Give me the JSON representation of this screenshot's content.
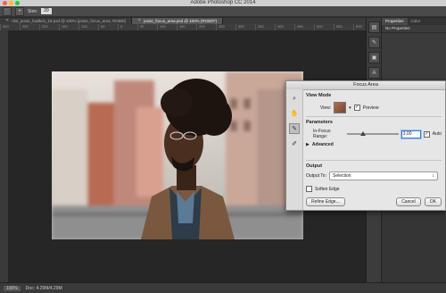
{
  "app": {
    "title": "Adobe Photoshop CC 2014",
    "traffic_light_colors": [
      "#ff5f57",
      "#febc2e",
      "#28c840"
    ]
  },
  "options_bar": {
    "tool_icon": "lasso-icon",
    "size_label": "Size:",
    "size_value": "20"
  },
  "tabs": [
    {
      "label": "rtist_jesse_fowlkes_18.psd @ 100% (jesse_focus_area, RGB/8)",
      "active": false
    },
    {
      "label": "jesse_focus_area.psd @ 100% (RGB/8*)",
      "active": true
    }
  ],
  "ruler": [
    "300",
    "250",
    "200",
    "150",
    "100",
    "50",
    "0",
    "50",
    "100",
    "150",
    "200",
    "250",
    "300",
    "350",
    "400",
    "450",
    "500",
    "550",
    "600"
  ],
  "right_panel": {
    "tabs": [
      "Properties",
      "Color"
    ],
    "subtitle": "No Properties"
  },
  "status": {
    "zoom": "100%",
    "doc": "Doc: 4.29M/4.29M"
  },
  "focus_area": {
    "title": "Focus Area",
    "view_mode_heading": "View Mode",
    "view_label": "View:",
    "preview_label": "Preview",
    "preview_checked": true,
    "parameters_heading": "Parameters",
    "range_label": "In-Focus Range:",
    "range_value": "3.00",
    "range_slider_fraction": 0.3,
    "auto_label": "Auto",
    "auto_checked": true,
    "advanced_label": "Advanced",
    "output_heading": "Output",
    "output_to_label": "Output To:",
    "output_to_value": "Selection",
    "soften_label": "Soften Edge",
    "soften_checked": false,
    "refine_label": "Refine Edge...",
    "cancel_label": "Cancel",
    "ok_label": "OK"
  }
}
